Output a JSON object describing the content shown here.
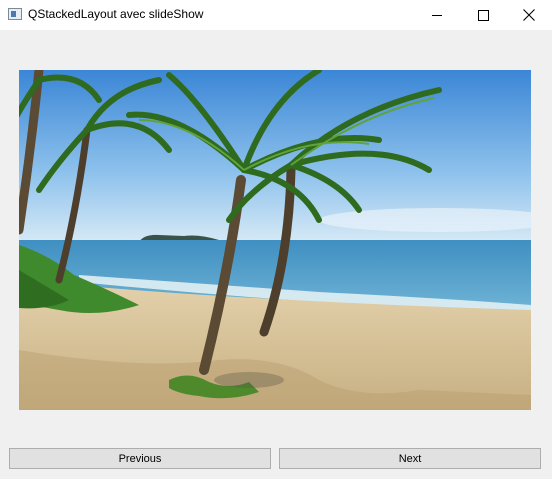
{
  "window": {
    "title": "QStackedLayout avec slideShow",
    "controls": {
      "minimize_icon": "minimize-icon",
      "maximize_icon": "maximize-icon",
      "close_icon": "close-icon"
    }
  },
  "slideshow": {
    "current_image": "tropical-beach-palm-trees",
    "previous_label": "Previous",
    "next_label": "Next"
  },
  "colors": {
    "window_bg": "#f0f0f0",
    "titlebar_bg": "#ffffff",
    "button_bg": "#e1e1e1",
    "button_border": "#adadad"
  }
}
